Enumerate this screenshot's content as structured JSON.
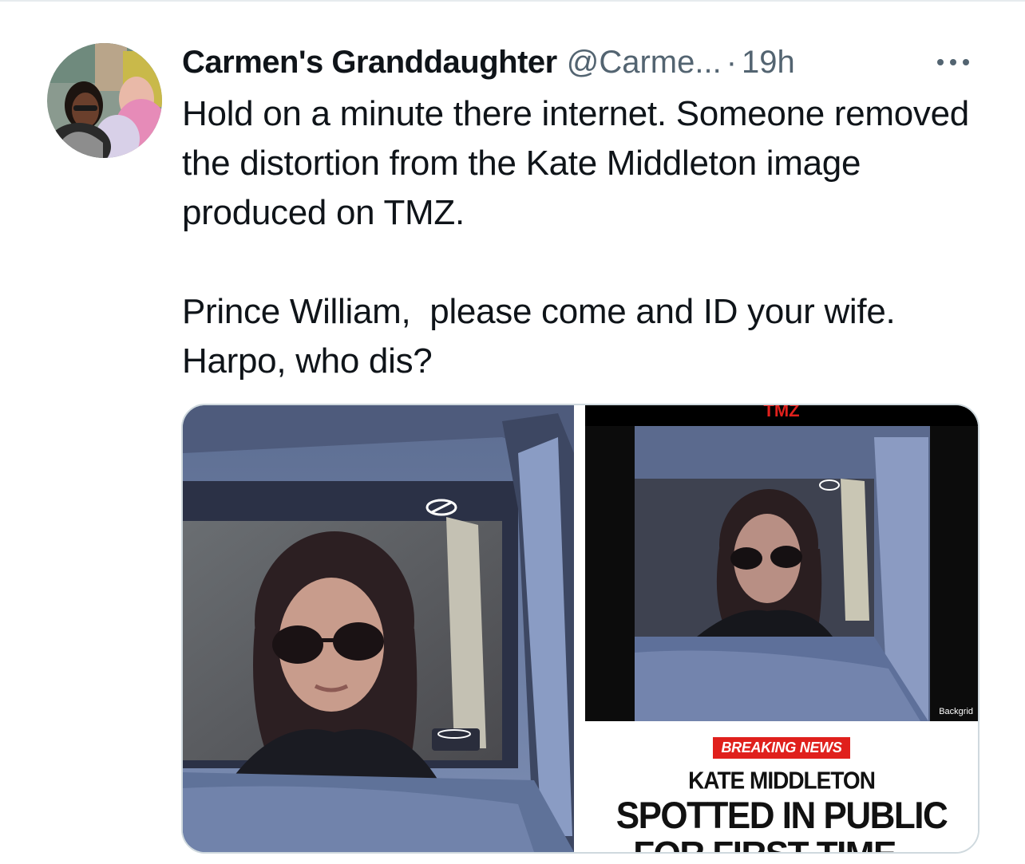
{
  "tweet": {
    "display_name": "Carmen's Granddaughter",
    "handle": "@Carme...",
    "separator": "·",
    "timestamp": "19h",
    "more_icon": "more-horizontal-icon",
    "text": "Hold on a minute there internet. Someone removed the distortion from the Kate Middleton image produced on TMZ.\n\nPrince William,  please come and ID your wife.\nHarpo, who dis?"
  },
  "media": {
    "right_image": {
      "site_logo": "TMZ",
      "photo_credit": "Backgrid",
      "badge": "BREAKING NEWS",
      "headline_line1": "KATE MIDDLETON",
      "headline_line2": "SPOTTED IN PUBLIC",
      "headline_line3": "FOR FIRST TIME ..."
    }
  },
  "colors": {
    "text_primary": "#0f1419",
    "text_secondary": "#536471",
    "border": "#cfd9de",
    "badge_red": "#e0201c"
  }
}
